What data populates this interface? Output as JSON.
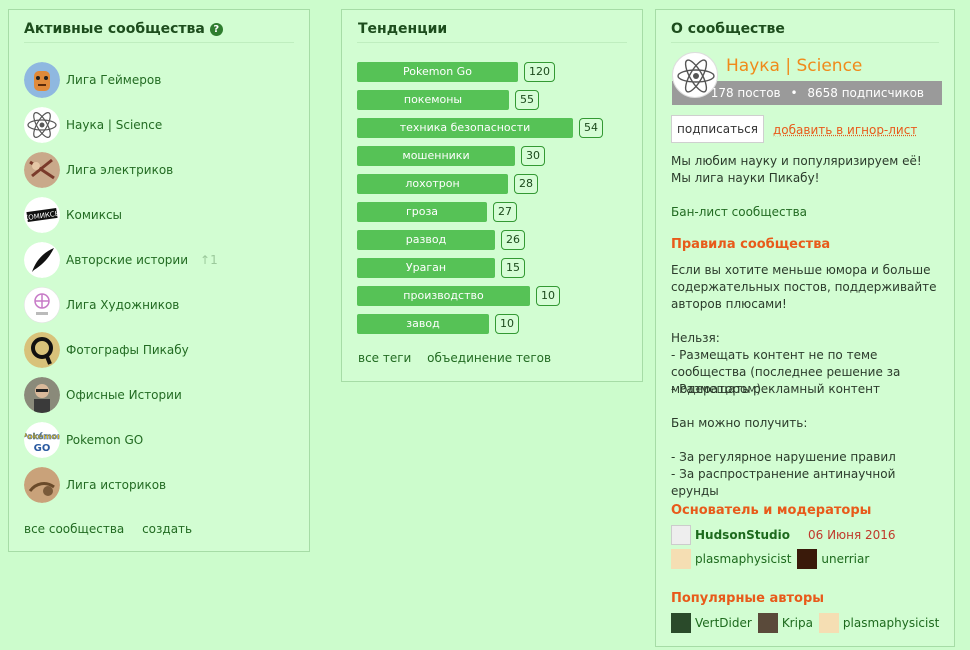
{
  "left": {
    "title": "Активные сообщества",
    "communities": [
      {
        "name": "Лига Геймеров",
        "icon": "gamer-avatar"
      },
      {
        "name": "Наука | Science",
        "icon": "atom-avatar"
      },
      {
        "name": "Лига электриков",
        "icon": "electrician-avatar"
      },
      {
        "name": "Комиксы",
        "icon": "comics-avatar"
      },
      {
        "name": "Авторские истории",
        "icon": "quill-avatar",
        "badge": "1"
      },
      {
        "name": "Лига Художников",
        "icon": "artist-avatar"
      },
      {
        "name": "Фотографы Пикабу",
        "icon": "photographer-avatar"
      },
      {
        "name": "Офисные Истории",
        "icon": "office-avatar"
      },
      {
        "name": "Pokemon GO",
        "icon": "pokemon-avatar"
      },
      {
        "name": "Лига историков",
        "icon": "history-avatar"
      }
    ],
    "footer": {
      "all": "все сообщества",
      "create": "создать"
    }
  },
  "middle": {
    "title": "Тенденции",
    "tags": [
      {
        "label": "Pokemon Go",
        "count": 120
      },
      {
        "label": "покемоны",
        "count": 55
      },
      {
        "label": "техника безопасности",
        "count": 54
      },
      {
        "label": "мошенники",
        "count": 30
      },
      {
        "label": "лохотрон",
        "count": 28
      },
      {
        "label": "гроза",
        "count": 27
      },
      {
        "label": "развод",
        "count": 26
      },
      {
        "label": "Ураган",
        "count": 15
      },
      {
        "label": "производство",
        "count": 10
      },
      {
        "label": "завод",
        "count": 10
      }
    ],
    "links": {
      "all_tags": "все теги",
      "merge": "объединение тегов"
    }
  },
  "right": {
    "title": "О сообществе",
    "community_name": "Наука | Science",
    "posts": "178 постов",
    "subscribers": "8658 подписчиков",
    "subscribe": "подписаться",
    "ignore": "добавить в игнор-лист",
    "description": "Мы любим науку и популяризируем её! Мы лига науки Пикабу!",
    "ban_list": "Бан-лист сообщества",
    "rules_title": "Правила сообщества",
    "rules_intro": "Если вы хотите меньше юмора и больше содержательных постов, поддерживайте авторов плюсами!",
    "rules_forbidden_title": "Нельзя:",
    "rules_forbidden_1": "- Размещать контент не по теме сообщества (последнее решение за модератором)",
    "rules_forbidden_2": "- Размещать рекламный контент",
    "ban_title": "Бан можно получить:",
    "ban_1": "- За регулярное нарушение правил",
    "ban_2": "- За распространение антинаучной ерунды",
    "mods_title": "Основатель и модераторы",
    "founder": "HudsonStudio",
    "founded_date": "06 Июня 2016",
    "mod1": "plasmaphysicist",
    "mod2": "unerriar",
    "authors_title": "Популярные авторы",
    "author1": "VertDider",
    "author2": "Kripa",
    "author3": "plasmaphysicist"
  }
}
